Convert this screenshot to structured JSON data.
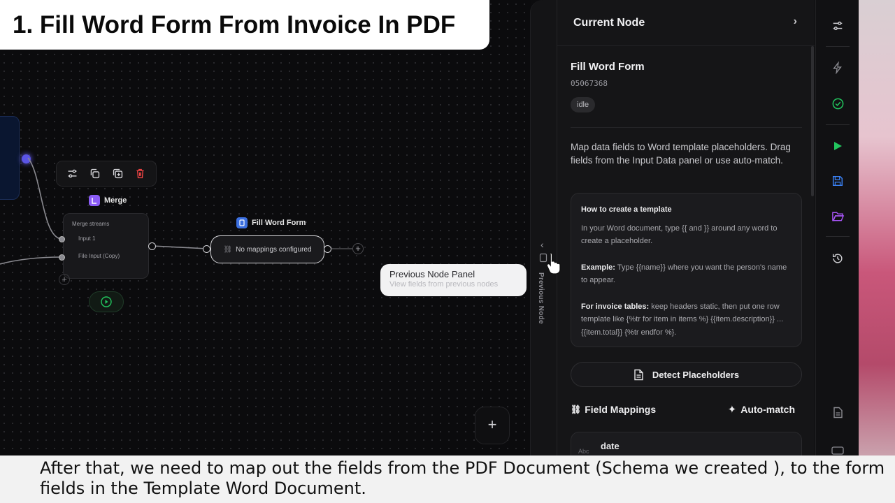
{
  "video_title": "1. Fill Word Form From Invoice In PDF",
  "subtitle": "After that, we need to map out the fields from the PDF Document (Schema we created ), to the form fields in the Template Word Document.",
  "canvas": {
    "merge_node": {
      "label": "Merge",
      "header": "Merge streams",
      "input1": "Input 1",
      "input2": "File Input (Copy)"
    },
    "fill_node": {
      "label": "Fill Word Form",
      "status": "No mappings configured"
    },
    "tooltip": {
      "title": "Previous Node Panel",
      "subtitle": "View fields from previous nodes"
    },
    "add_button": "+"
  },
  "prev_strip": {
    "label": "Previous Node"
  },
  "panel": {
    "header": "Current Node",
    "node_title": "Fill Word Form",
    "node_id": "05067368",
    "status": "idle",
    "description": "Map data fields to Word template placeholders. Drag fields from the Input Data panel or use auto-match.",
    "howto": {
      "heading": "How to create a template",
      "p1": "In your Word document, type {{ and }} around any word to create a placeholder.",
      "example_label": "Example:",
      "example_text": " Type {{name}} where you want the person's name to appear.",
      "invoice_label": "For invoice tables:",
      "invoice_text": " keep headers static, then put one row template like {%tr for item in items %} {{item.description}} ... {{item.total}} {%tr endfor %}."
    },
    "detect_button": "Detect Placeholders",
    "field_mappings_label": "Field Mappings",
    "auto_match_label": "Auto-match",
    "mapping_card": {
      "type_hint": "Abc",
      "field": "date"
    }
  },
  "colors": {
    "accent_purple": "#5b54e6",
    "merge_badge": "#8b5cf6",
    "word_badge": "#3b6fe0",
    "rail_green": "#22c55e",
    "rail_blue": "#3b82f6",
    "rail_purple": "#a855f7",
    "delete_red": "#ef4444"
  }
}
